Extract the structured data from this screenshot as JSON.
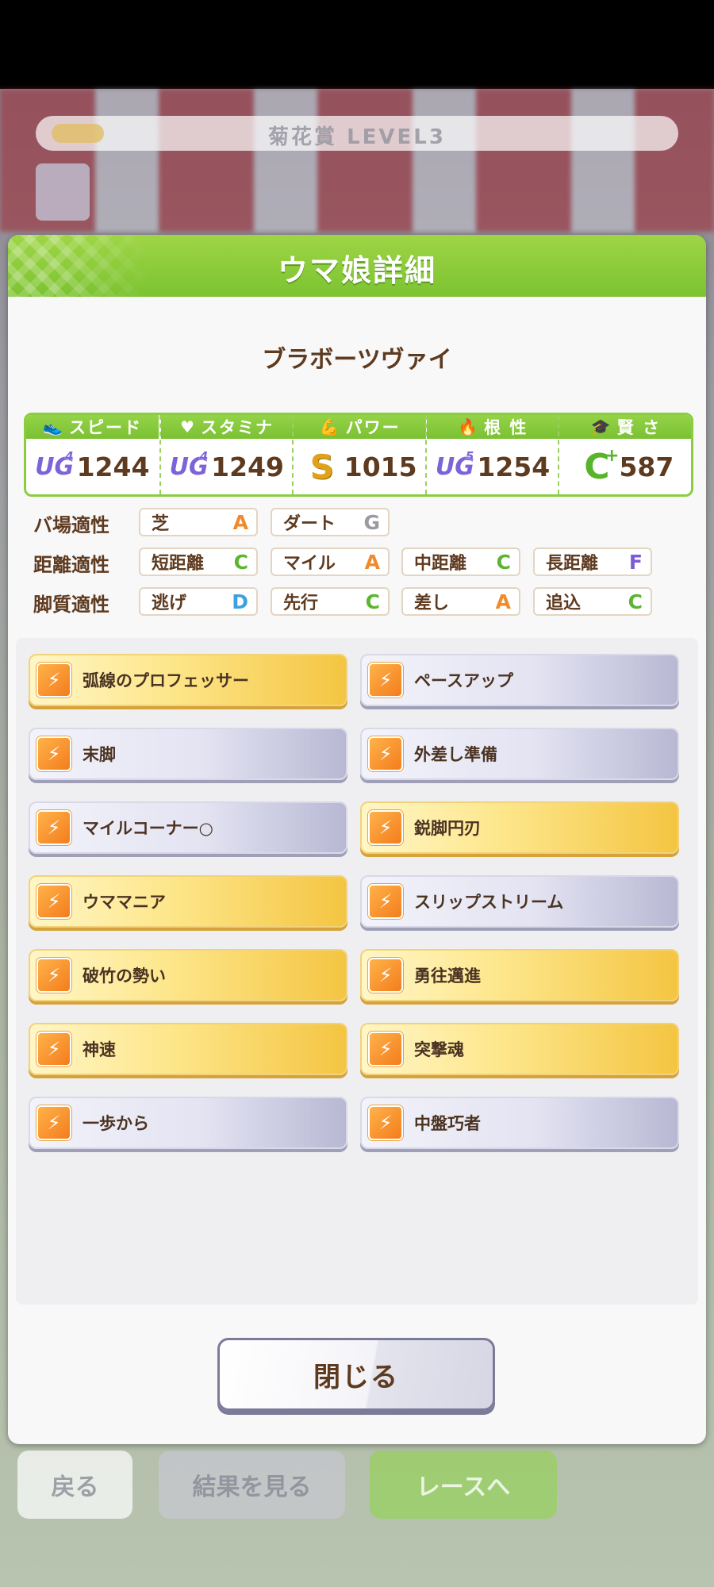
{
  "background": {
    "race_title": "菊花賞 LEVEL3",
    "back_label": "戻る",
    "result_label": "結果を見る",
    "race_button_label": "レースへ"
  },
  "modal": {
    "title": "ウマ娘詳細",
    "character_name": "ブラボーツヴァイ"
  },
  "stats": [
    {
      "label": "スピード",
      "icon": "shoe-icon",
      "glyph": "👟",
      "rank": "UG",
      "rank_level": "4",
      "value": "1244"
    },
    {
      "label": "スタミナ",
      "icon": "heart-icon",
      "glyph": "♥",
      "rank": "UG",
      "rank_level": "4",
      "value": "1249"
    },
    {
      "label": "パワー",
      "icon": "muscle-icon",
      "glyph": "💪",
      "rank": "S",
      "rank_level": "",
      "value": "1015"
    },
    {
      "label": "根 性",
      "icon": "flame-icon",
      "glyph": "🔥",
      "rank": "UG",
      "rank_level": "5",
      "value": "1254"
    },
    {
      "label": "賢 さ",
      "icon": "graduation-cap-icon",
      "glyph": "🎓",
      "rank": "C",
      "rank_level": "+",
      "value": "587"
    }
  ],
  "aptitudes": {
    "track": {
      "label": "バ場適性",
      "items": [
        {
          "name": "芝",
          "grade": "A"
        },
        {
          "name": "ダート",
          "grade": "G"
        }
      ]
    },
    "distance": {
      "label": "距離適性",
      "items": [
        {
          "name": "短距離",
          "grade": "C"
        },
        {
          "name": "マイル",
          "grade": "A"
        },
        {
          "name": "中距離",
          "grade": "C"
        },
        {
          "name": "長距離",
          "grade": "F"
        }
      ]
    },
    "style": {
      "label": "脚質適性",
      "items": [
        {
          "name": "逃げ",
          "grade": "D"
        },
        {
          "name": "先行",
          "grade": "C"
        },
        {
          "name": "差し",
          "grade": "A"
        },
        {
          "name": "追込",
          "grade": "C"
        }
      ]
    }
  },
  "skills": [
    {
      "name": "弧線のプロフェッサー",
      "tier": "gold"
    },
    {
      "name": "ペースアップ",
      "tier": "silver"
    },
    {
      "name": "末脚",
      "tier": "silver"
    },
    {
      "name": "外差し準備",
      "tier": "silver"
    },
    {
      "name": "マイルコーナー○",
      "tier": "silver"
    },
    {
      "name": "鋭脚円刃",
      "tier": "gold"
    },
    {
      "name": "ウママニア",
      "tier": "gold"
    },
    {
      "name": "スリップストリーム",
      "tier": "silver"
    },
    {
      "name": "破竹の勢い",
      "tier": "gold"
    },
    {
      "name": "勇往邁進",
      "tier": "gold"
    },
    {
      "name": "神速",
      "tier": "gold"
    },
    {
      "name": "突撃魂",
      "tier": "gold"
    },
    {
      "name": "一歩から",
      "tier": "silver"
    },
    {
      "name": "中盤巧者",
      "tier": "silver"
    }
  ],
  "close_button": {
    "label": "閉じる"
  },
  "colors": {
    "header_green": "#7cc331",
    "text_brown": "#5e3a1f",
    "grade_A": "#f08a2d",
    "grade_C": "#5cb531",
    "grade_D": "#3ea0e0",
    "grade_F": "#7b5bd6",
    "grade_G": "#9a9aa2"
  }
}
